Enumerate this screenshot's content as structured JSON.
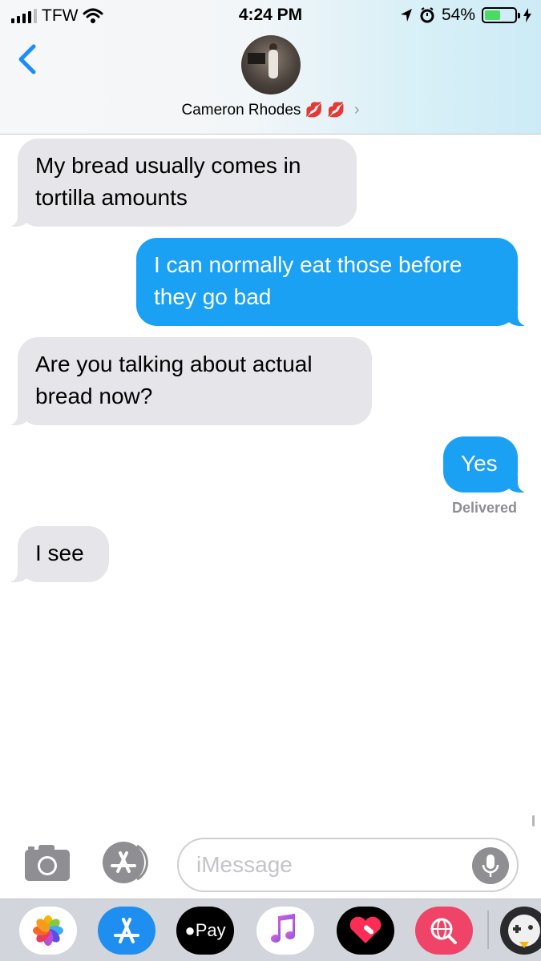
{
  "status_bar": {
    "carrier": "TFW",
    "time": "4:24 PM",
    "battery_percent": "54%",
    "battery_level": 0.54
  },
  "header": {
    "contact_name": "Cameron  Rhodes",
    "contact_emoji": "💋 💋",
    "chevron": "›"
  },
  "messages": [
    {
      "direction": "received",
      "text": "My bread usually comes in tortilla amounts"
    },
    {
      "direction": "sent",
      "text": "I can normally eat those before they go bad"
    },
    {
      "direction": "received",
      "text": "Are you talking about actual bread now?"
    },
    {
      "direction": "sent",
      "text": "Yes"
    },
    {
      "direction": "received",
      "text": "I see"
    }
  ],
  "delivered_label": "Delivered",
  "input": {
    "placeholder": "iMessage"
  },
  "app_drawer": {
    "apps": [
      {
        "name": "photos-app",
        "icon": "photos-icon"
      },
      {
        "name": "app-store-app",
        "icon": "app-store-icon"
      },
      {
        "name": "apple-pay-app",
        "icon": "apple-pay-icon",
        "label": "Pay"
      },
      {
        "name": "music-app",
        "icon": "music-note-icon"
      },
      {
        "name": "digital-touch-app",
        "icon": "heart-icon"
      },
      {
        "name": "images-search-app",
        "icon": "globe-search-icon"
      },
      {
        "name": "game-app",
        "icon": "game-character-icon"
      }
    ]
  },
  "colors": {
    "sent_bubble": "#1aa1f4",
    "received_bubble": "#e5e5ea",
    "accent": "#1a8cff",
    "battery_fill": "#4cd964"
  }
}
